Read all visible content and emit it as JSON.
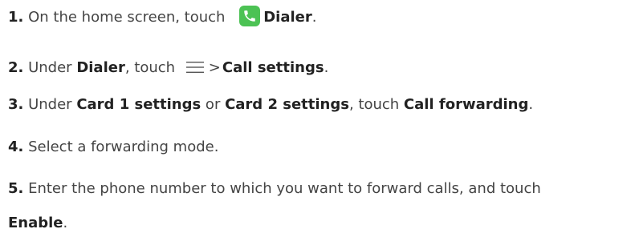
{
  "steps": [
    {
      "number": "1.",
      "text_before": " On the home screen, touch ",
      "icon": "dialer-phone-icon",
      "bold": "Dialer",
      "text_after": "."
    },
    {
      "number": "2.",
      "text_before": " Under ",
      "bold1": "Dialer",
      "text_middle": ", touch ",
      "icon": "menu-icon",
      "separator": ">",
      "bold2": "Call settings",
      "text_after": "."
    },
    {
      "number": "3.",
      "text_before": " Under ",
      "bold1": "Card 1 settings",
      "text_or": " or ",
      "bold2": "Card 2 settings",
      "text_middle": ", touch ",
      "bold3": "Call forwarding",
      "text_after": "."
    },
    {
      "number": "4.",
      "text": " Select a forwarding mode."
    },
    {
      "number": "5.",
      "text": " Enter the phone number to which you want to forward calls, and touch",
      "bold": "Enable",
      "text_after": "."
    }
  ],
  "colors": {
    "dialer_icon_bg": "#4cc254",
    "text": "#444444"
  }
}
